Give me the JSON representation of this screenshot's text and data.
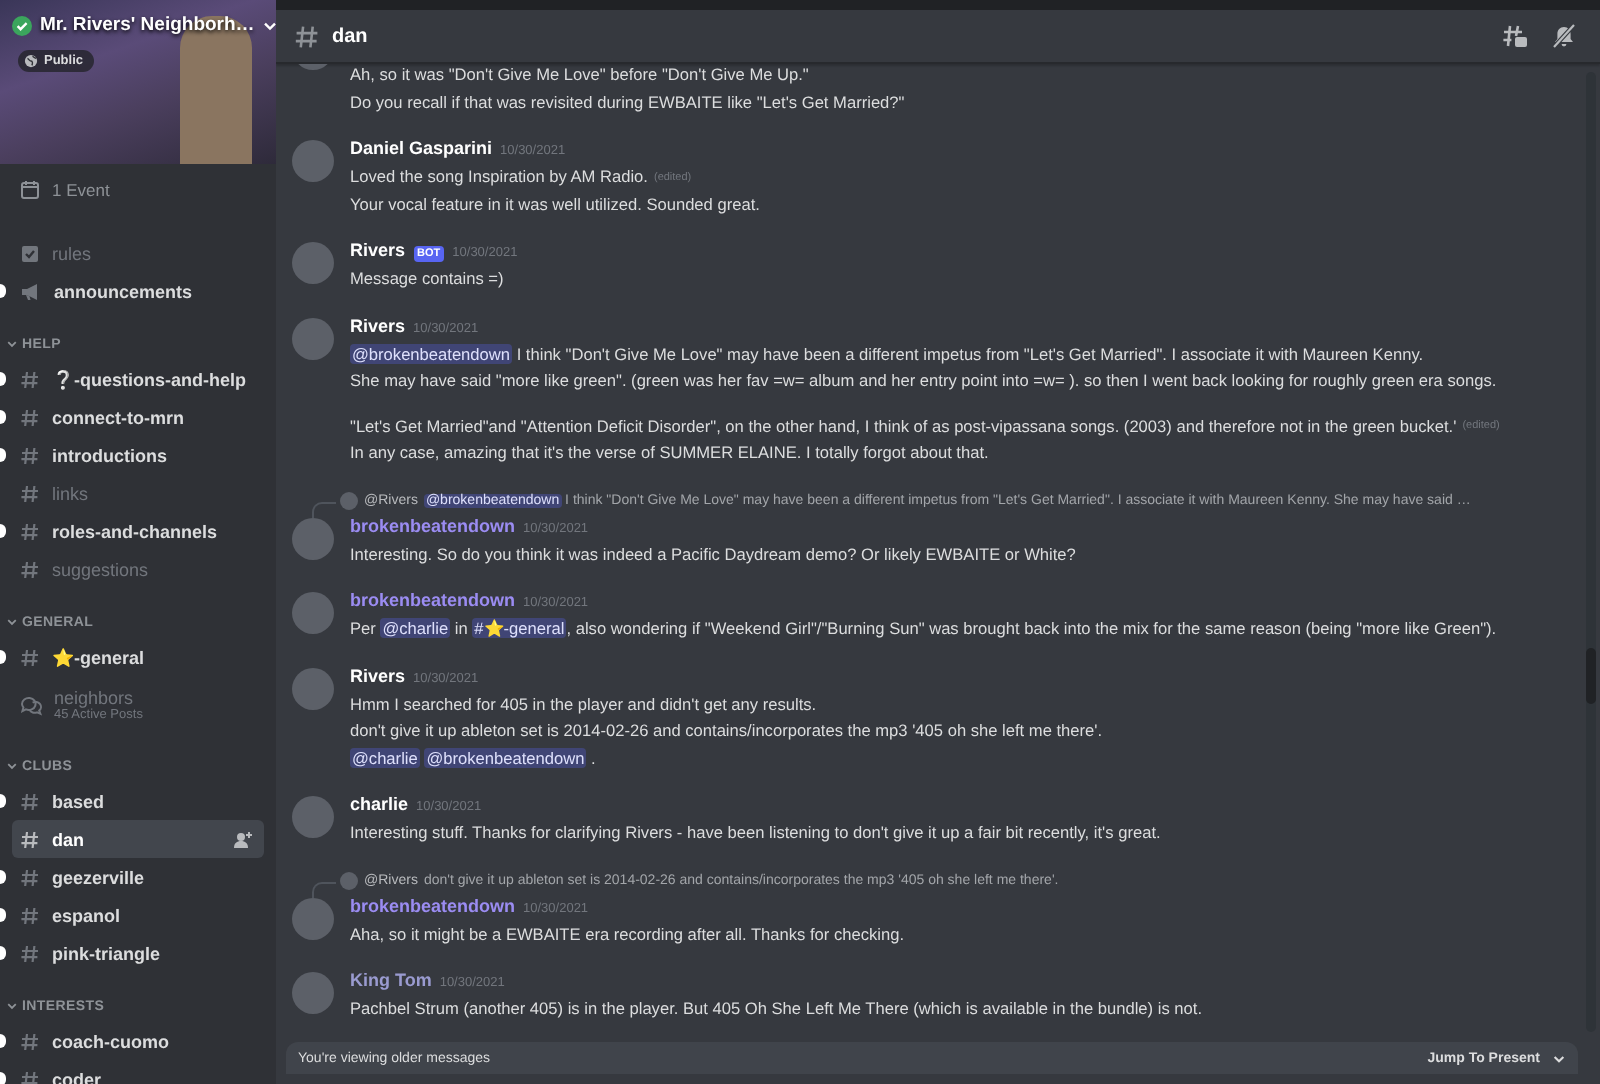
{
  "server": {
    "name": "Mr. Rivers' Neighborh…",
    "badge": "Public"
  },
  "events": {
    "label": "1 Event"
  },
  "channels": [
    {
      "name": "rules",
      "kind": "rules",
      "unread": false,
      "selected": false
    },
    {
      "name": "announcements",
      "kind": "announcement",
      "unread": true,
      "selected": false
    }
  ],
  "categories": [
    {
      "name": "HELP",
      "expanded": true,
      "channels": [
        {
          "name": "❔-questions-and-help",
          "kind": "text",
          "unread": true,
          "selected": false
        },
        {
          "name": "connect-to-mrn",
          "kind": "text",
          "unread": true,
          "selected": false
        },
        {
          "name": "introductions",
          "kind": "text",
          "unread": true,
          "selected": false
        },
        {
          "name": "links",
          "kind": "text",
          "unread": false,
          "selected": false
        },
        {
          "name": "roles-and-channels",
          "kind": "text",
          "unread": true,
          "selected": false
        },
        {
          "name": "suggestions",
          "kind": "text",
          "unread": false,
          "selected": false
        }
      ]
    },
    {
      "name": "GENERAL",
      "expanded": true,
      "channels": [
        {
          "name": "⭐-general",
          "kind": "text",
          "unread": true,
          "selected": false
        },
        {
          "name": "neighbors",
          "kind": "forum",
          "subtitle": "45 Active Posts",
          "unread": false,
          "selected": false
        }
      ]
    },
    {
      "name": "CLUBS",
      "expanded": true,
      "channels": [
        {
          "name": "based",
          "kind": "text",
          "unread": true,
          "selected": false
        },
        {
          "name": "dan",
          "kind": "text",
          "unread": false,
          "selected": true
        },
        {
          "name": "geezerville",
          "kind": "text",
          "unread": true,
          "selected": false
        },
        {
          "name": "espanol",
          "kind": "text",
          "unread": true,
          "selected": false
        },
        {
          "name": "pink-triangle",
          "kind": "text",
          "unread": true,
          "selected": false
        }
      ]
    },
    {
      "name": "INTERESTS",
      "expanded": true,
      "channels": [
        {
          "name": "coach-cuomo",
          "kind": "text",
          "unread": true,
          "selected": false
        },
        {
          "name": "coder",
          "kind": "text",
          "unread": true,
          "selected": false
        }
      ]
    }
  ],
  "channel_header": {
    "name": "dan"
  },
  "messages": [
    {
      "kind": "continuation",
      "lines": [
        {
          "segments": [
            {
              "kind": "text",
              "text": "Ah, so it was \"Don't Give Me Love\" before \"Don't Give Me Up.\""
            }
          ]
        },
        {
          "segments": [
            {
              "kind": "text",
              "text": "Do you recall if that was revisited during EWBAITE like \"Let's Get Married?\""
            }
          ]
        }
      ]
    },
    {
      "kind": "group",
      "author": "Daniel Gasparini",
      "color": "#ffffff",
      "timestamp": "10/30/2021",
      "lines": [
        {
          "segments": [
            {
              "kind": "text",
              "text": "Loved the song Inspiration by AM Radio."
            }
          ],
          "edited": "(edited)"
        },
        {
          "segments": [
            {
              "kind": "text",
              "text": "Your vocal feature in it was well utilized. Sounded great."
            }
          ]
        }
      ]
    },
    {
      "kind": "group",
      "author": "Rivers",
      "color": "#ffffff",
      "bot_tag": "BOT",
      "timestamp": "10/30/2021",
      "lines": [
        {
          "segments": [
            {
              "kind": "text",
              "text": "Message contains =)"
            }
          ]
        }
      ]
    },
    {
      "kind": "group",
      "author": "Rivers",
      "color": "#ffffff",
      "timestamp": "10/30/2021",
      "lines": [
        {
          "segments": [
            {
              "kind": "mention",
              "text": "@brokenbeatendown"
            },
            {
              "kind": "text",
              "text": " I think \"Don't Give Me Love\" may have been a different impetus from  \"Let's Get Married\". I associate it with Maureen Kenny."
            }
          ]
        },
        {
          "segments": [
            {
              "kind": "text",
              "text": "She may have said \"more like green\". (green was her fav =w= album and her entry point into =w= ). so then I went back looking for roughly green era songs."
            }
          ]
        },
        {
          "gap_before": true,
          "segments": [
            {
              "kind": "text",
              "text": "\"Let's Get Married\"and \"Attention Deficit Disorder\", on the other hand, I think of as post-vipassana songs. (2003) and therefore not in the green bucket.'"
            }
          ],
          "edited": "(edited)"
        },
        {
          "segments": [
            {
              "kind": "text",
              "text": "In any case, amazing that it's the verse of SUMMER ELAINE. I totally forgot about that."
            }
          ]
        }
      ]
    },
    {
      "kind": "group",
      "author": "brokenbeatendown",
      "color": "#9b8cf2",
      "timestamp": "10/30/2021",
      "reply": {
        "author": "@Rivers",
        "segments": [
          {
            "kind": "mention",
            "text": "@brokenbeatendown"
          },
          {
            "kind": "text",
            "text": " I think \"Don't Give Me Love\" may have been a different impetus from  \"Let's Get Married\". I associate it with Maureen Kenny.  She may have said …"
          }
        ]
      },
      "lines": [
        {
          "segments": [
            {
              "kind": "text",
              "text": "Interesting. So do you think it was indeed a Pacific Daydream demo? Or likely EWBAITE or White?"
            }
          ]
        }
      ]
    },
    {
      "kind": "group",
      "author": "brokenbeatendown",
      "color": "#9b8cf2",
      "timestamp": "10/30/2021",
      "lines": [
        {
          "segments": [
            {
              "kind": "text",
              "text": "Per "
            },
            {
              "kind": "mention",
              "text": "@charlie"
            },
            {
              "kind": "text",
              "text": " in "
            },
            {
              "kind": "channel",
              "text": "#⭐-general"
            },
            {
              "kind": "text",
              "text": ", also wondering if \"Weekend Girl\"/\"Burning Sun\" was brought back into the mix for the same reason (being \"more like Green\")."
            }
          ]
        }
      ]
    },
    {
      "kind": "group",
      "author": "Rivers",
      "color": "#ffffff",
      "timestamp": "10/30/2021",
      "lines": [
        {
          "segments": [
            {
              "kind": "text",
              "text": "Hmm I searched for 405 in the player and didn't get any results."
            }
          ]
        },
        {
          "segments": [
            {
              "kind": "text",
              "text": "don't give it up ableton set is 2014-02-26 and contains/incorporates the mp3 '405 oh she left me there'."
            }
          ]
        },
        {
          "segments": [
            {
              "kind": "mention",
              "text": "@charlie"
            },
            {
              "kind": "mention",
              "text": "@brokenbeatendown"
            },
            {
              "kind": "text",
              "text": " ."
            }
          ]
        }
      ]
    },
    {
      "kind": "group",
      "author": "charlie",
      "color": "#ffffff",
      "timestamp": "10/30/2021",
      "lines": [
        {
          "segments": [
            {
              "kind": "text",
              "text": "Interesting stuff. Thanks for clarifying Rivers - have been listening to don't give it up a fair bit recently, it's great."
            }
          ]
        }
      ]
    },
    {
      "kind": "group",
      "author": "brokenbeatendown",
      "color": "#9b8cf2",
      "timestamp": "10/30/2021",
      "reply": {
        "author": "@Rivers",
        "segments": [
          {
            "kind": "text",
            "text": "don't give it up ableton set is 2014-02-26 and contains/incorporates the mp3 '405 oh she left me there'."
          }
        ]
      },
      "lines": [
        {
          "segments": [
            {
              "kind": "text",
              "text": "Aha, so it might be a EWBAITE era recording after all. Thanks for checking."
            }
          ]
        }
      ]
    },
    {
      "kind": "group",
      "author": "King Tom",
      "color": "#9a9bd0",
      "timestamp": "10/30/2021",
      "lines": [
        {
          "segments": [
            {
              "kind": "text",
              "text": "Pachbel Strum (another 405) is in the player. But 405 Oh She Left Me There (which is available in the bundle) is not."
            }
          ]
        }
      ]
    }
  ],
  "older_messages_bar": {
    "text": "You're viewing older messages",
    "action": "Jump To Present"
  }
}
